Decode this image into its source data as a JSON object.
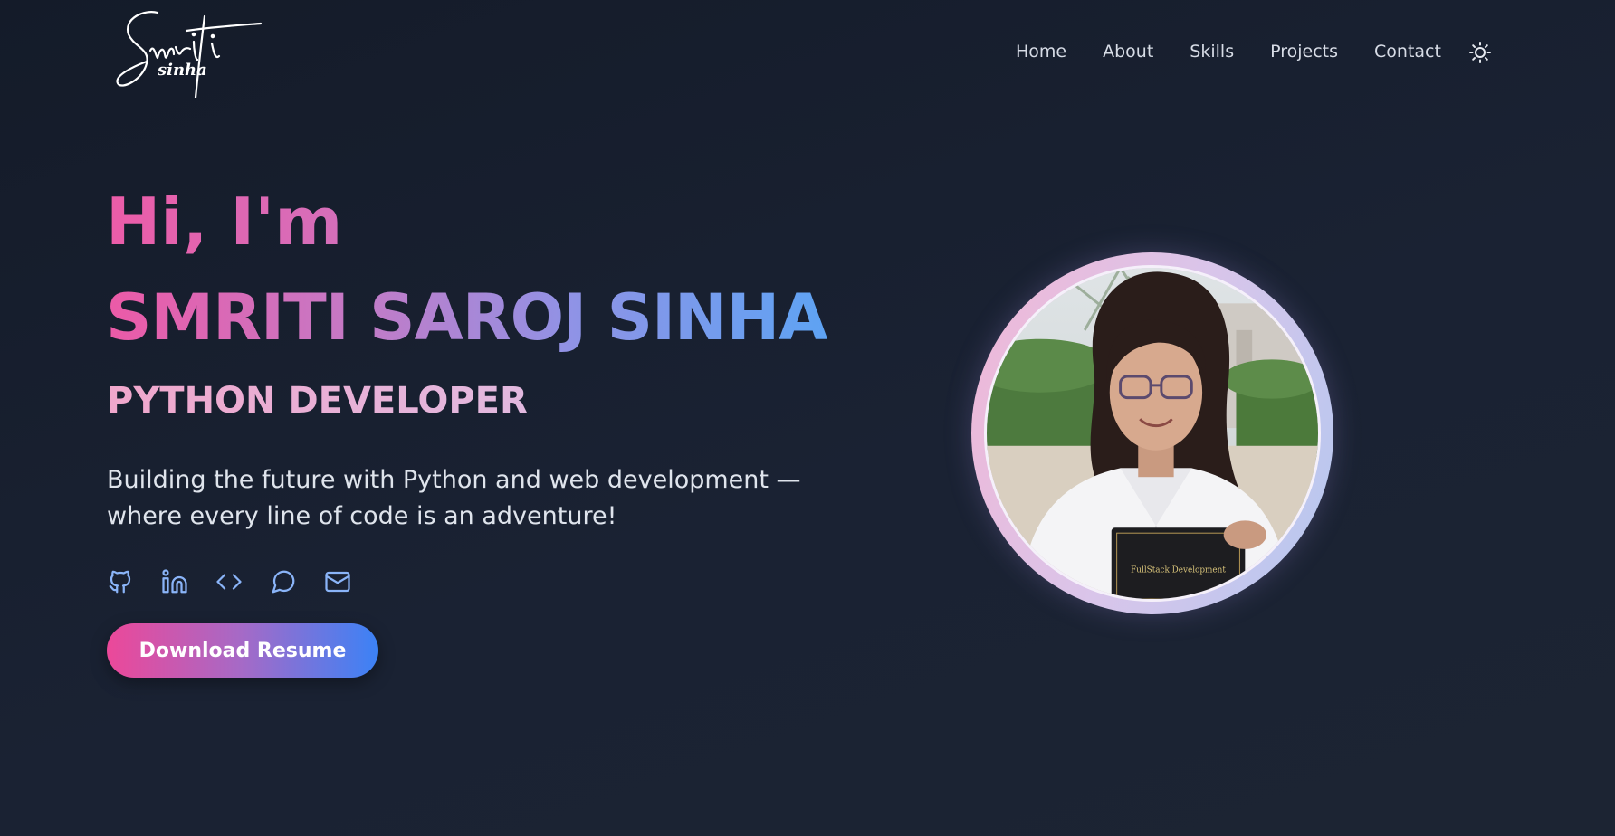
{
  "header": {
    "logo_sub": "sinha",
    "nav": [
      "Home",
      "About",
      "Skills",
      "Projects",
      "Contact"
    ]
  },
  "hero": {
    "greeting": "Hi, I'm",
    "name": "SMRITI SAROJ SINHA",
    "role": "PYTHON DEVELOPER",
    "tagline_line1": "Building the future with Python and web development —",
    "tagline_line2": "where every line of code is an adventure!",
    "resume_button": "Download Resume",
    "certificate_text": "FullStack Development"
  },
  "socials": [
    "github-icon",
    "linkedin-icon",
    "code-icon",
    "message-icon",
    "mail-icon"
  ],
  "colors": {
    "background": "#161d2b",
    "accent_pink": "#ec4899",
    "accent_blue": "#3b82f6",
    "icon_blue": "#8ab4f8"
  }
}
